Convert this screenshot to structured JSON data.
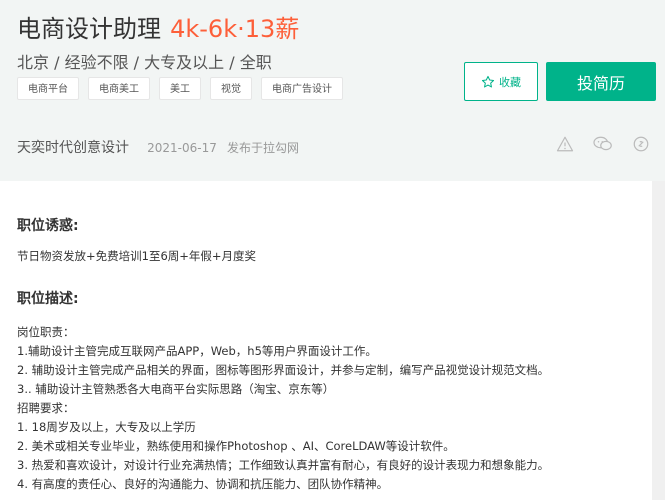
{
  "job": {
    "title": "电商设计助理",
    "salary": "4k-6k·13薪",
    "subline": "北京 / 经验不限 / 大专及以上 / 全职",
    "tags": [
      "电商平台",
      "电商美工",
      "美工",
      "视觉",
      "电商广告设计"
    ]
  },
  "actions": {
    "collect_label": "收藏",
    "apply_label": "投简历"
  },
  "company": {
    "name": "天奕时代创意设计",
    "date": "2021-06-17",
    "source": "发布于拉勾网"
  },
  "icons": [
    "warning-icon",
    "wechat-icon",
    "link-icon"
  ],
  "colors": {
    "accent": "#00b38a",
    "salary": "#fd5f39"
  },
  "sections": {
    "benefits_title": "职位诱惑:",
    "benefits_text": "节日物资发放+免费培训1至6周+年假+月度奖",
    "desc_title": "职位描述:",
    "desc_lines": [
      "岗位职责：",
      "1.辅助设计主管完成互联网产品APP，Web，h5等用户界面设计工作。",
      "2. 辅助设计主管完成产品相关的界面，图标等图形界面设计，并参与定制，编写产品视觉设计规范文档。",
      "3.. 辅助设计主管熟悉各大电商平台实际思路（淘宝、京东等）",
      "招聘要求：",
      "1. 18周岁及以上，大专及以上学历",
      "2. 美术或相关专业毕业，熟练使用和操作Photoshop 、AI、CoreLDAW等设计软件。",
      "3. 热爱和喜欢设计，对设计行业充满热情；工作细致认真并富有耐心，有良好的设计表现力和想象能力。",
      "4. 有高度的责任心、良好的沟通能力、协调和抗压能力、团队协作精神。"
    ]
  }
}
